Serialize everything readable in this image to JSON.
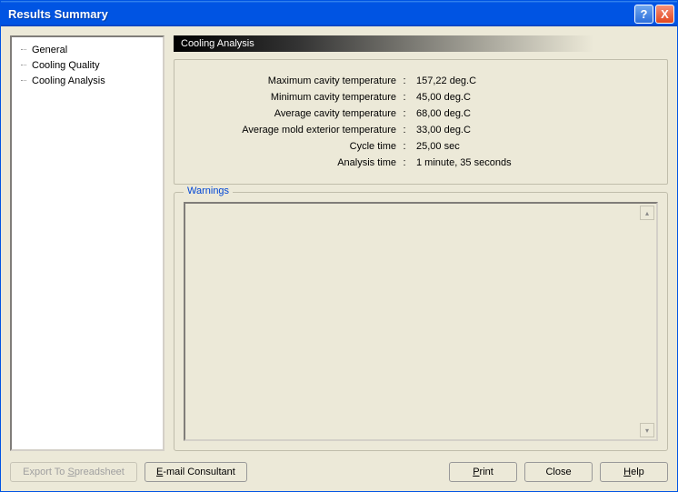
{
  "window": {
    "title": "Results Summary"
  },
  "sidebar": {
    "items": [
      {
        "label": "General"
      },
      {
        "label": "Cooling Quality"
      },
      {
        "label": "Cooling Analysis"
      }
    ],
    "selected_index": 2
  },
  "main": {
    "section_title": "Cooling Analysis",
    "rows": [
      {
        "label": "Maximum cavity temperature",
        "value": "157,22 deg.C"
      },
      {
        "label": "Minimum cavity temperature",
        "value": "45,00 deg.C"
      },
      {
        "label": "Average cavity temperature",
        "value": "68,00 deg.C"
      },
      {
        "label": "Average mold exterior temperature",
        "value": "33,00 deg.C"
      },
      {
        "label": "Cycle time",
        "value": "25,00 sec"
      },
      {
        "label": "Analysis time",
        "value": "1 minute, 35 seconds"
      }
    ],
    "warnings_title": "Warnings",
    "warnings_text": ""
  },
  "footer": {
    "export_label": "Export To Spreadsheet",
    "email_label": "E-mail Consultant",
    "print_label": "Print",
    "close_label": "Close",
    "help_label": "Help"
  },
  "titlebar_buttons": {
    "help": "?",
    "close": "X"
  }
}
